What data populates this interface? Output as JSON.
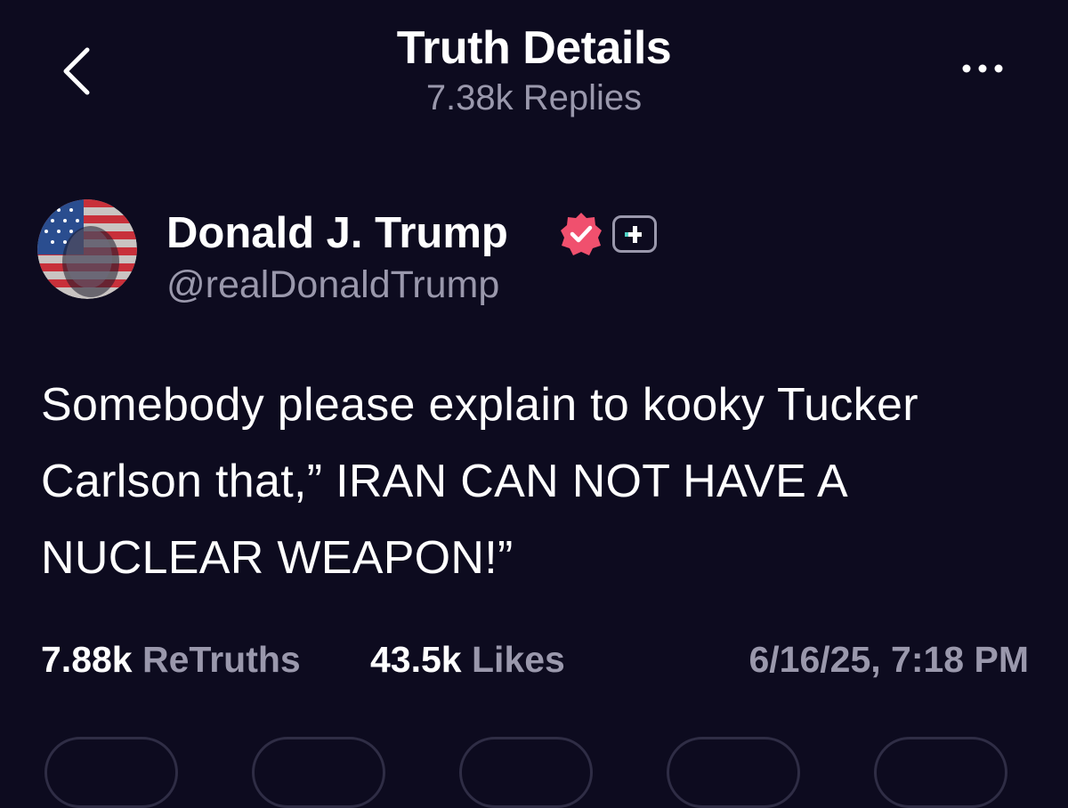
{
  "header": {
    "title": "Truth Details",
    "subtitle": "7.38k Replies",
    "back_icon": "chevron-left-icon",
    "more_icon": "more-horizontal-icon"
  },
  "author": {
    "name": "Donald J. Trump",
    "handle": "@realDonaldTrump",
    "verified_color": "#f0506e",
    "verified_icon": "verified-badge-icon",
    "badge_icon": "plus-badge-icon",
    "badge_accent": "#4fd1c5"
  },
  "post": {
    "text": "Somebody please explain to kooky Tucker Carlson that,” IRAN CAN NOT HAVE A NUCLEAR WEAPON!”"
  },
  "stats": {
    "retruths_count": "7.88k",
    "retruths_label": "ReTruths",
    "likes_count": "43.5k",
    "likes_label": "Likes",
    "timestamp": "6/16/25, 7:18 PM"
  },
  "colors": {
    "background": "#0d0b1f",
    "text_primary": "#ffffff",
    "text_secondary": "#9a98ac"
  }
}
